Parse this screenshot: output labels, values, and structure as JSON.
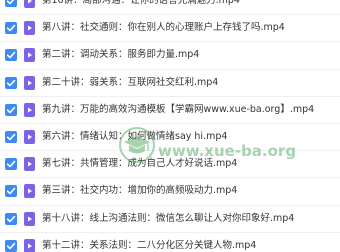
{
  "files": [
    {
      "name": "第16讲：局部沟通：让你的语言充满魅力.mp4"
    },
    {
      "name": "第八讲：社交通则：你在别人的心理账户上存钱了吗.mp4"
    },
    {
      "name": "第二讲：调动关系：服务即力量.mp4"
    },
    {
      "name": "第二十讲：弱关系：互联网社交红利.mp4"
    },
    {
      "name": "第九讲：万能的高效沟通模板【学霸网www.xue-ba.org】.mp4"
    },
    {
      "name": "第六讲：情绪认知：如何做情绪say hi.mp4"
    },
    {
      "name": "第七讲：共情管理：成为自己人才好说话.mp4"
    },
    {
      "name": "第三讲：社交内功：增加你的高频吸动力.mp4"
    },
    {
      "name": "第十八讲：线上沟通法则：微信怎么聊让人对你印象好.mp4"
    },
    {
      "name": "第十二讲：关系法则：二八分化区分关键人物.mp4"
    }
  ],
  "watermark": {
    "text": "www.xue-ba.org",
    "icon": "graduation-cap-icon"
  },
  "colors": {
    "checkbox": "#3d8af7",
    "file_icon": "#7a63e8",
    "watermark": "#3f9f4f"
  }
}
